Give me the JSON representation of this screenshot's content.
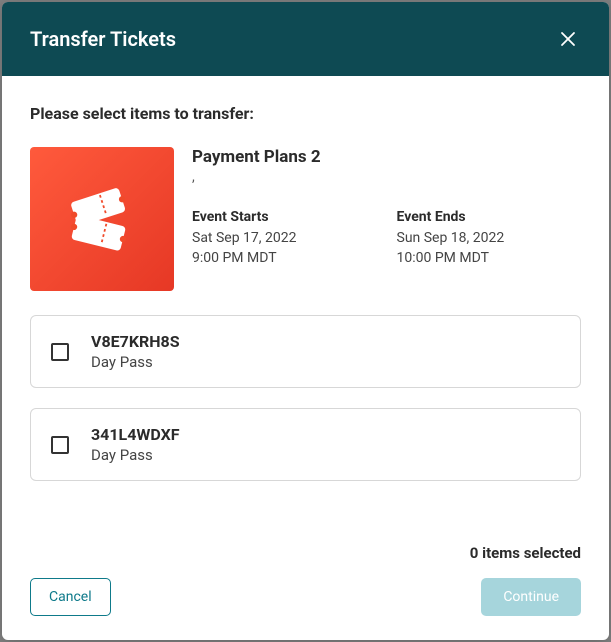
{
  "header": {
    "title": "Transfer Tickets"
  },
  "instruction": "Please select items to transfer:",
  "event": {
    "name": "Payment Plans 2",
    "subinfo": ",",
    "start_label": "Event Starts",
    "start_date": "Sat Sep 17, 2022",
    "start_time": "9:00 PM MDT",
    "end_label": "Event Ends",
    "end_date": "Sun Sep 18, 2022",
    "end_time": "10:00 PM MDT"
  },
  "tickets": [
    {
      "code": "V8E7KRH8S",
      "type": "Day Pass"
    },
    {
      "code": "341L4WDXF",
      "type": "Day Pass"
    }
  ],
  "footer": {
    "selected_text": "0 items selected",
    "cancel_label": "Cancel",
    "continue_label": "Continue"
  }
}
